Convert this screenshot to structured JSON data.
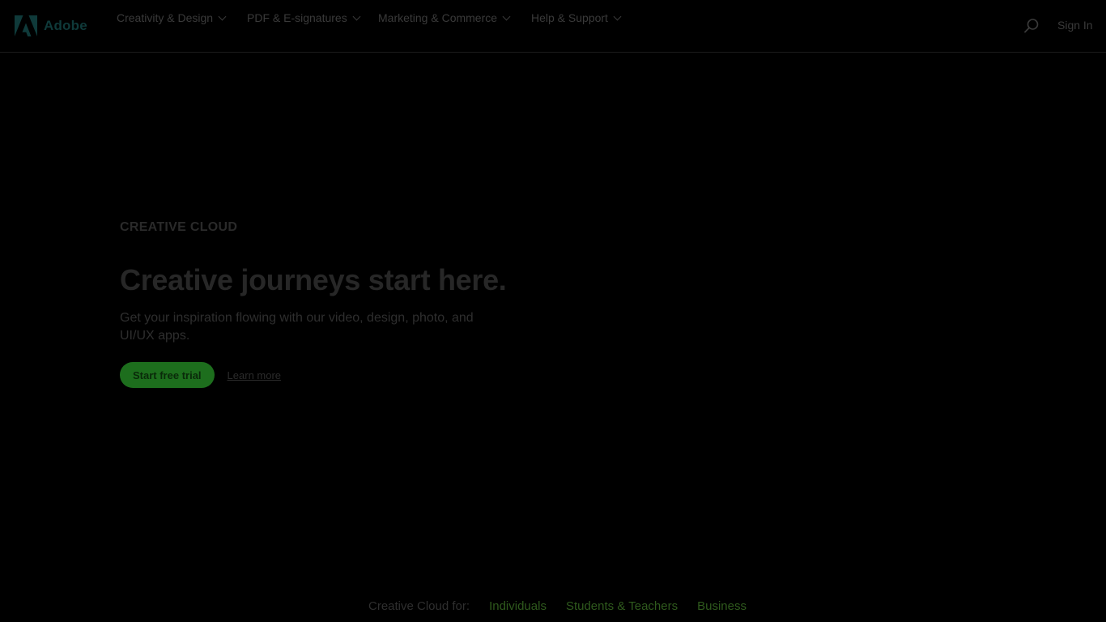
{
  "colors": {
    "background": "#000000",
    "brand_dark": "#0f3a3a",
    "primary_button": "#1d6e1d",
    "link_green": "#2f5a1d"
  },
  "header": {
    "logo_text": "Adobe",
    "nav": [
      {
        "label": "Creativity & Design",
        "icon": "chevron-down-icon"
      },
      {
        "label": "PDF & E-signatures",
        "icon": "chevron-down-icon"
      },
      {
        "label": "Marketing & Commerce",
        "icon": "chevron-down-icon"
      },
      {
        "label": "Help & Support",
        "icon": "chevron-down-icon"
      }
    ],
    "search_icon": "search-icon",
    "sign_in": "Sign In"
  },
  "hero": {
    "eyebrow": "CREATIVE CLOUD",
    "headline": "Creative journeys start here.",
    "description": "Get your inspiration flowing with our video, design, photo, and UI/UX apps.",
    "primary_cta": "Start free trial",
    "secondary_cta": "Learn more"
  },
  "audience_strip": {
    "label": "Creative Cloud for:",
    "links": [
      "Individuals",
      "Students & Teachers",
      "Business"
    ]
  }
}
